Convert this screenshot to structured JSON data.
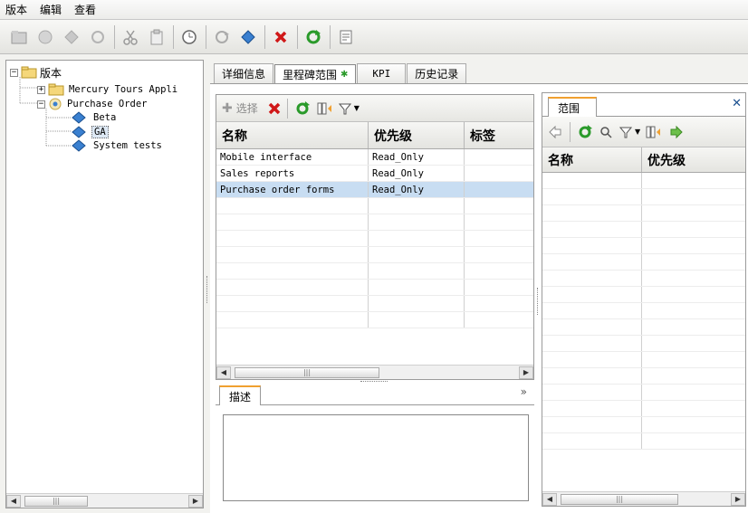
{
  "menu": [
    "版本",
    "编辑",
    "查看"
  ],
  "toolbar_icons": [
    "new-folder-icon",
    "new-release-icon",
    "new-cycle-icon",
    "cycle-icon",
    "cut-icon",
    "paste-icon",
    "timeline-icon",
    "refresh-link-icon",
    "milestone-icon",
    "delete-icon",
    "refresh-icon",
    "details-icon"
  ],
  "tree": {
    "root": "版本",
    "items": [
      {
        "label": "Mercury Tours Appli",
        "level": 1,
        "kind": "folder",
        "expander": "+"
      },
      {
        "label": "Purchase Order",
        "level": 1,
        "kind": "release",
        "expander": "−"
      },
      {
        "label": "Beta",
        "level": 2,
        "kind": "milestone"
      },
      {
        "label": "GA",
        "level": 2,
        "kind": "milestone",
        "selected": true
      },
      {
        "label": "System tests",
        "level": 2,
        "kind": "milestone"
      }
    ]
  },
  "tabs": [
    {
      "label": "详细信息"
    },
    {
      "label": "里程碑范围",
      "active": true
    },
    {
      "label": "KPI"
    },
    {
      "label": "历史记录"
    }
  ],
  "scope": {
    "select_label": "选择",
    "columns": [
      "名称",
      "优先级",
      "标签"
    ],
    "rows": [
      {
        "name": "Mobile interface",
        "priority": "Read_Only",
        "tag": ""
      },
      {
        "name": "Sales reports",
        "priority": "Read_Only",
        "tag": ""
      },
      {
        "name": "Purchase order forms",
        "priority": "Read_Only",
        "tag": "",
        "selected": true
      }
    ],
    "empty_rows": 9
  },
  "description": {
    "tab_label": "描述",
    "text": ""
  },
  "range_panel": {
    "tab_label": "范围",
    "columns": [
      "名称",
      "优先级"
    ],
    "empty_rows": 15
  },
  "colors": {
    "selection": "#c8ddf2",
    "accent_tab": "#f0a030",
    "delete_red": "#d01818",
    "refresh_green": "#2a9a2a",
    "milestone_blue": "#3a80d0"
  }
}
